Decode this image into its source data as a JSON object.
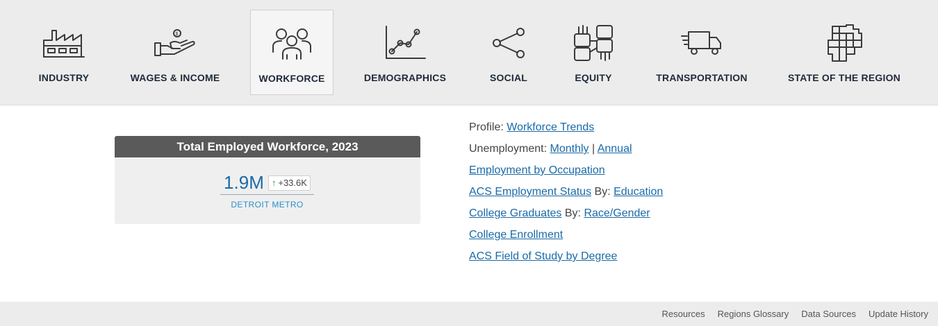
{
  "nav": {
    "items": [
      {
        "label": "INDUSTRY",
        "icon": "factory-icon"
      },
      {
        "label": "WAGES & INCOME",
        "icon": "hand-coin-icon"
      },
      {
        "label": "WORKFORCE",
        "icon": "people-group-icon",
        "active": true
      },
      {
        "label": "DEMOGRAPHICS",
        "icon": "line-graph-icon"
      },
      {
        "label": "SOCIAL",
        "icon": "share-icon"
      },
      {
        "label": "EQUITY",
        "icon": "joined-hands-icon"
      },
      {
        "label": "TRANSPORTATION",
        "icon": "truck-icon"
      },
      {
        "label": "STATE OF THE REGION",
        "icon": "map-counties-icon"
      }
    ]
  },
  "card": {
    "title": "Total Employed Workforce, 2023",
    "value": "1.9M",
    "delta": "+33.6K",
    "delta_direction": "up",
    "region": "DETROIT METRO",
    "colors": {
      "header": "#5a5a5a",
      "value": "#1a6aa8",
      "delta_up": "#2e9a3a",
      "region": "#2a8fc9"
    }
  },
  "links": {
    "profile_prefix": "Profile:",
    "profile_link": "Workforce Trends",
    "unemployment_prefix": "Unemployment:",
    "unemployment_monthly": "Monthly",
    "separator": "|",
    "unemployment_annual": "Annual",
    "employment_by_occupation": "Employment by Occupation",
    "acs_employment_status": "ACS Employment Status",
    "by_label_1": "By:",
    "education": "Education",
    "college_graduates": "College Graduates",
    "by_label_2": "By:",
    "race_gender": "Race/Gender",
    "college_enrollment": "College Enrollment",
    "acs_field_of_study": "ACS Field of Study by Degree"
  },
  "footer": {
    "links": [
      "Resources",
      "Regions Glossary",
      "Data Sources",
      "Update History"
    ]
  }
}
